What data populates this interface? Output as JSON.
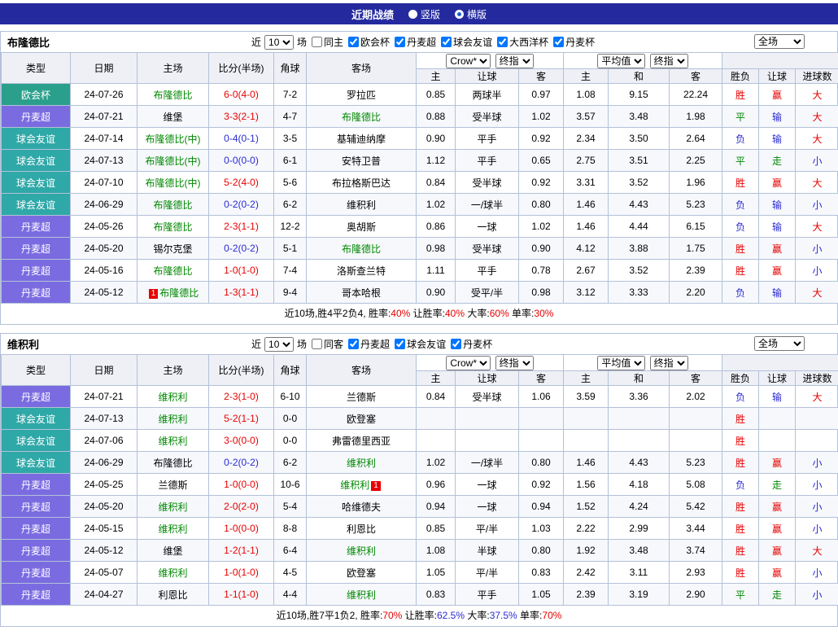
{
  "title_bar": {
    "title": "近期战绩",
    "options": [
      {
        "label": "竖版",
        "selected": false
      },
      {
        "label": "横版",
        "selected": true
      }
    ]
  },
  "ui": {
    "recent_prefix": "近",
    "recent_suffix": "场",
    "headers": {
      "type": "类型",
      "date": "日期",
      "home": "主场",
      "score": "比分(半场)",
      "corner": "角球",
      "away": "客场",
      "h": "主",
      "handicap": "让球",
      "a": "客",
      "draw": "和",
      "winloss": "胜负",
      "goals": "进球数"
    },
    "selects": {
      "bookmaker": "Crow*",
      "stage": "终指",
      "average": "平均值",
      "full": "全场"
    },
    "league_colors": {
      "欧会杯": "#2aa08c",
      "丹麦超": "#7b6be0",
      "球会友谊": "#2fa8a8"
    },
    "result_colors": {
      "胜": "#e60000",
      "平": "#008800",
      "负": "#2a2ad0",
      "赢": "#e60000",
      "输": "#2a2ad0",
      "走": "#008800",
      "大": "#e60000",
      "小": "#2a2ad0"
    },
    "score_colors": {
      "r": "#e60000",
      "b": "#2a2ad0"
    },
    "team_highlight": "#008800",
    "badge_bg": "#e60000"
  },
  "sections": [
    {
      "team": "布隆德比",
      "filters": {
        "count": "10",
        "same_label": "同主",
        "same_checked": false,
        "leagues": [
          {
            "label": "欧会杯",
            "checked": true
          },
          {
            "label": "丹麦超",
            "checked": true
          },
          {
            "label": "球会友谊",
            "checked": true
          },
          {
            "label": "大西洋杯",
            "checked": true
          },
          {
            "label": "丹麦杯",
            "checked": true
          }
        ]
      },
      "rows": [
        {
          "league": "欧会杯",
          "date": "24-07-26",
          "home": {
            "t": "布隆德比",
            "hl": true
          },
          "score": "6-0(4-0)",
          "sc": "r",
          "corner": "7-2",
          "away": {
            "t": "罗拉匹"
          },
          "odds": [
            "0.85",
            "两球半",
            "0.97",
            "1.08",
            "9.15",
            "22.24"
          ],
          "res": [
            "胜",
            "赢",
            "大"
          ]
        },
        {
          "league": "丹麦超",
          "date": "24-07-21",
          "home": {
            "t": "维堡"
          },
          "score": "3-3(2-1)",
          "sc": "r",
          "corner": "4-7",
          "away": {
            "t": "布隆德比",
            "hl": true
          },
          "odds": [
            "0.88",
            "受半球",
            "1.02",
            "3.57",
            "3.48",
            "1.98"
          ],
          "res": [
            "平",
            "输",
            "大"
          ]
        },
        {
          "league": "球会友谊",
          "date": "24-07-14",
          "home": {
            "t": "布隆德比(中)",
            "hl": true
          },
          "score": "0-4(0-1)",
          "sc": "b",
          "corner": "3-5",
          "away": {
            "t": "基辅迪纳摩"
          },
          "odds": [
            "0.90",
            "平手",
            "0.92",
            "2.34",
            "3.50",
            "2.64"
          ],
          "res": [
            "负",
            "输",
            "大"
          ]
        },
        {
          "league": "球会友谊",
          "date": "24-07-13",
          "home": {
            "t": "布隆德比(中)",
            "hl": true
          },
          "score": "0-0(0-0)",
          "sc": "b",
          "corner": "6-1",
          "away": {
            "t": "安特卫普"
          },
          "odds": [
            "1.12",
            "平手",
            "0.65",
            "2.75",
            "3.51",
            "2.25"
          ],
          "res": [
            "平",
            "走",
            "小"
          ]
        },
        {
          "league": "球会友谊",
          "date": "24-07-10",
          "home": {
            "t": "布隆德比(中)",
            "hl": true
          },
          "score": "5-2(4-0)",
          "sc": "r",
          "corner": "5-6",
          "away": {
            "t": "布拉格斯巴达"
          },
          "odds": [
            "0.84",
            "受半球",
            "0.92",
            "3.31",
            "3.52",
            "1.96"
          ],
          "res": [
            "胜",
            "赢",
            "大"
          ]
        },
        {
          "league": "球会友谊",
          "date": "24-06-29",
          "home": {
            "t": "布隆德比",
            "hl": true
          },
          "score": "0-2(0-2)",
          "sc": "b",
          "corner": "6-2",
          "away": {
            "t": "维积利"
          },
          "odds": [
            "1.02",
            "一/球半",
            "0.80",
            "1.46",
            "4.43",
            "5.23"
          ],
          "res": [
            "负",
            "输",
            "小"
          ]
        },
        {
          "league": "丹麦超",
          "date": "24-05-26",
          "home": {
            "t": "布隆德比",
            "hl": true
          },
          "score": "2-3(1-1)",
          "sc": "r",
          "corner": "12-2",
          "away": {
            "t": "奥胡斯"
          },
          "odds": [
            "0.86",
            "一球",
            "1.02",
            "1.46",
            "4.44",
            "6.15"
          ],
          "res": [
            "负",
            "输",
            "大"
          ]
        },
        {
          "league": "丹麦超",
          "date": "24-05-20",
          "home": {
            "t": "锡尔克堡"
          },
          "score": "0-2(0-2)",
          "sc": "b",
          "corner": "5-1",
          "away": {
            "t": "布隆德比",
            "hl": true
          },
          "odds": [
            "0.98",
            "受半球",
            "0.90",
            "4.12",
            "3.88",
            "1.75"
          ],
          "res": [
            "胜",
            "赢",
            "小"
          ]
        },
        {
          "league": "丹麦超",
          "date": "24-05-16",
          "home": {
            "t": "布隆德比",
            "hl": true
          },
          "score": "1-0(1-0)",
          "sc": "r",
          "corner": "7-4",
          "away": {
            "t": "洛斯查兰特"
          },
          "odds": [
            "1.11",
            "平手",
            "0.78",
            "2.67",
            "3.52",
            "2.39"
          ],
          "res": [
            "胜",
            "赢",
            "小"
          ]
        },
        {
          "league": "丹麦超",
          "date": "24-05-12",
          "home": {
            "t": "布隆德比",
            "hl": true,
            "badge": "1",
            "badge_pos": "before"
          },
          "score": "1-3(1-1)",
          "sc": "r",
          "corner": "9-4",
          "away": {
            "t": "哥本哈根"
          },
          "odds": [
            "0.90",
            "受平/半",
            "0.98",
            "3.12",
            "3.33",
            "2.20"
          ],
          "res": [
            "负",
            "输",
            "大"
          ]
        }
      ],
      "summary": [
        {
          "t": "近10场,胜4平2负4, ",
          "c": "#000000"
        },
        {
          "t": "胜率:",
          "c": "#000000"
        },
        {
          "t": "40%",
          "c": "#e60000"
        },
        {
          "t": " 让胜率:",
          "c": "#000000"
        },
        {
          "t": "40%",
          "c": "#e60000"
        },
        {
          "t": " 大率:",
          "c": "#000000"
        },
        {
          "t": "60%",
          "c": "#e60000"
        },
        {
          "t": " 单率:",
          "c": "#000000"
        },
        {
          "t": "30%",
          "c": "#e60000"
        }
      ]
    },
    {
      "team": "维积利",
      "filters": {
        "count": "10",
        "same_label": "同客",
        "same_checked": false,
        "leagues": [
          {
            "label": "丹麦超",
            "checked": true
          },
          {
            "label": "球会友谊",
            "checked": true
          },
          {
            "label": "丹麦杯",
            "checked": true
          }
        ]
      },
      "rows": [
        {
          "league": "丹麦超",
          "date": "24-07-21",
          "home": {
            "t": "维积利",
            "hl": true
          },
          "score": "2-3(1-0)",
          "sc": "r",
          "corner": "6-10",
          "away": {
            "t": "兰德斯"
          },
          "odds": [
            "0.84",
            "受半球",
            "1.06",
            "3.59",
            "3.36",
            "2.02"
          ],
          "res": [
            "负",
            "输",
            "大"
          ]
        },
        {
          "league": "球会友谊",
          "date": "24-07-13",
          "home": {
            "t": "维积利",
            "hl": true
          },
          "score": "5-2(1-1)",
          "sc": "r",
          "corner": "0-0",
          "away": {
            "t": "欧登塞"
          },
          "odds": [
            "",
            "",
            "",
            "",
            "",
            ""
          ],
          "res": [
            "胜",
            "",
            ""
          ]
        },
        {
          "league": "球会友谊",
          "date": "24-07-06",
          "home": {
            "t": "维积利",
            "hl": true
          },
          "score": "3-0(0-0)",
          "sc": "r",
          "corner": "0-0",
          "away": {
            "t": "弗雷德里西亚"
          },
          "odds": [
            "",
            "",
            "",
            "",
            "",
            ""
          ],
          "res": [
            "胜",
            "",
            ""
          ]
        },
        {
          "league": "球会友谊",
          "date": "24-06-29",
          "home": {
            "t": "布隆德比"
          },
          "score": "0-2(0-2)",
          "sc": "b",
          "corner": "6-2",
          "away": {
            "t": "维积利",
            "hl": true
          },
          "odds": [
            "1.02",
            "一/球半",
            "0.80",
            "1.46",
            "4.43",
            "5.23"
          ],
          "res": [
            "胜",
            "赢",
            "小"
          ]
        },
        {
          "league": "丹麦超",
          "date": "24-05-25",
          "home": {
            "t": "兰德斯"
          },
          "score": "1-0(0-0)",
          "sc": "r",
          "corner": "10-6",
          "away": {
            "t": "维积利",
            "hl": true,
            "badge": "1",
            "badge_pos": "after"
          },
          "odds": [
            "0.96",
            "一球",
            "0.92",
            "1.56",
            "4.18",
            "5.08"
          ],
          "res": [
            "负",
            "走",
            "小"
          ]
        },
        {
          "league": "丹麦超",
          "date": "24-05-20",
          "home": {
            "t": "维积利",
            "hl": true
          },
          "score": "2-0(2-0)",
          "sc": "r",
          "corner": "5-4",
          "away": {
            "t": "哈维德夫"
          },
          "odds": [
            "0.94",
            "一球",
            "0.94",
            "1.52",
            "4.24",
            "5.42"
          ],
          "res": [
            "胜",
            "赢",
            "小"
          ]
        },
        {
          "league": "丹麦超",
          "date": "24-05-15",
          "home": {
            "t": "维积利",
            "hl": true
          },
          "score": "1-0(0-0)",
          "sc": "r",
          "corner": "8-8",
          "away": {
            "t": "利恩比"
          },
          "odds": [
            "0.85",
            "平/半",
            "1.03",
            "2.22",
            "2.99",
            "3.44"
          ],
          "res": [
            "胜",
            "赢",
            "小"
          ]
        },
        {
          "league": "丹麦超",
          "date": "24-05-12",
          "home": {
            "t": "维堡"
          },
          "score": "1-2(1-1)",
          "sc": "r",
          "corner": "6-4",
          "away": {
            "t": "维积利",
            "hl": true
          },
          "odds": [
            "1.08",
            "半球",
            "0.80",
            "1.92",
            "3.48",
            "3.74"
          ],
          "res": [
            "胜",
            "赢",
            "大"
          ]
        },
        {
          "league": "丹麦超",
          "date": "24-05-07",
          "home": {
            "t": "维积利",
            "hl": true
          },
          "score": "1-0(1-0)",
          "sc": "r",
          "corner": "4-5",
          "away": {
            "t": "欧登塞"
          },
          "odds": [
            "1.05",
            "平/半",
            "0.83",
            "2.42",
            "3.11",
            "2.93"
          ],
          "res": [
            "胜",
            "赢",
            "小"
          ]
        },
        {
          "league": "丹麦超",
          "date": "24-04-27",
          "home": {
            "t": "利恩比"
          },
          "score": "1-1(1-0)",
          "sc": "r",
          "corner": "4-4",
          "away": {
            "t": "维积利",
            "hl": true
          },
          "odds": [
            "0.83",
            "平手",
            "1.05",
            "2.39",
            "3.19",
            "2.90"
          ],
          "res": [
            "平",
            "走",
            "小"
          ]
        }
      ],
      "summary": [
        {
          "t": "近10场,胜7平1负2, ",
          "c": "#000000"
        },
        {
          "t": "胜率:",
          "c": "#000000"
        },
        {
          "t": "70%",
          "c": "#e60000"
        },
        {
          "t": " 让胜率:",
          "c": "#000000"
        },
        {
          "t": "62.5%",
          "c": "#2a2ad0"
        },
        {
          "t": " 大率:",
          "c": "#000000"
        },
        {
          "t": "37.5%",
          "c": "#2a2ad0"
        },
        {
          "t": " 单率:",
          "c": "#000000"
        },
        {
          "t": "70%",
          "c": "#e60000"
        }
      ]
    }
  ]
}
